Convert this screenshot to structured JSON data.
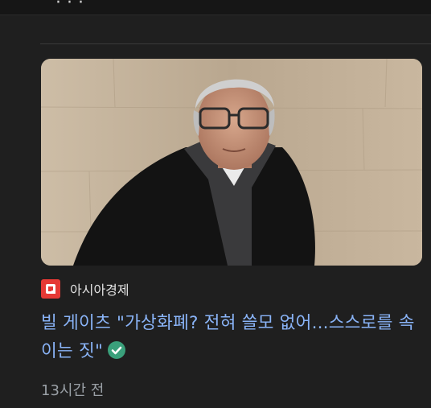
{
  "top": {
    "partial_heading": "' ·  · ·"
  },
  "article": {
    "image_alt": "Photo of Bill Gates",
    "source": {
      "name": "아시아경제",
      "logo_color": "#e53935",
      "logo_icon": "asiae-logo-icon"
    },
    "headline": "빌 게이츠 \"가상화폐? 전혀 쓸모 없어...스스로를 속이는 짓\"",
    "verified_icon": "verified-check-icon",
    "verified_color": "#3aa07b",
    "time": "13시간 전"
  },
  "colors": {
    "background": "#1f1f1f",
    "headline": "#8ab4f8",
    "meta": "#9aa0a6"
  }
}
